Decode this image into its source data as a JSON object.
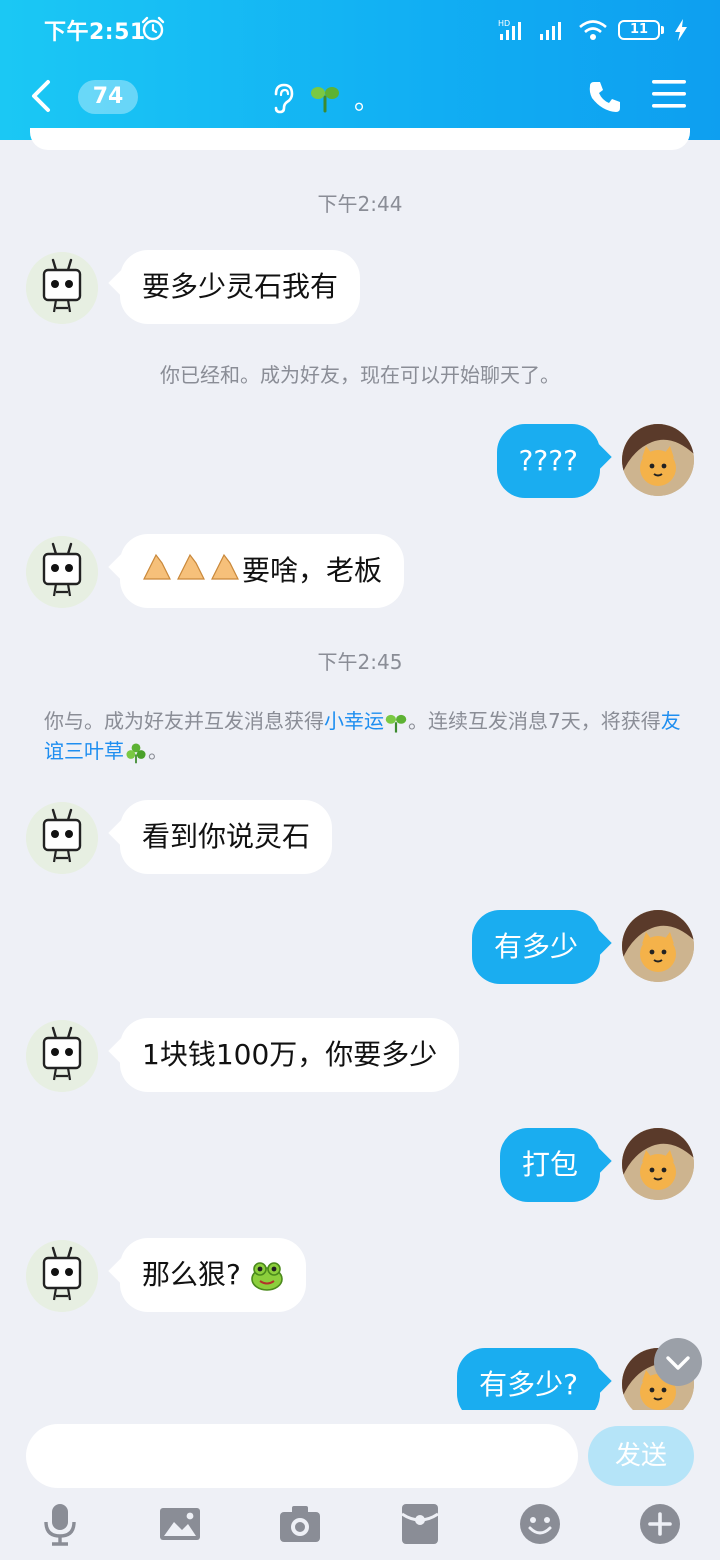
{
  "status_bar": {
    "time": "下午2:51",
    "battery": "11"
  },
  "header": {
    "unread_count": "74",
    "title_suffix": "。"
  },
  "chat": {
    "timestamp_1": "下午2:44",
    "msg_1": "要多少灵石我有",
    "system_1": "你已经和。成为好友，现在可以开始聊天了。",
    "msg_2": "????",
    "msg_3_text": "要啥，老板",
    "timestamp_2": "下午2:45",
    "system_2": {
      "part_1": "你与。成为好友并互发消息获得",
      "link_1": "小幸运",
      "part_2": "。连续互发消息7天，将获得",
      "link_2": "友谊三叶草",
      "part_3": "。"
    },
    "msg_4": "看到你说灵石",
    "msg_5": "有多少",
    "msg_6": "1块钱100万，你要多少",
    "msg_7": "打包",
    "msg_8_text": "那么狠?",
    "msg_9": "有多少?"
  },
  "input": {
    "placeholder": "",
    "send_label": "发送"
  },
  "icons": [
    "alarm-icon",
    "signal-icon",
    "wifi-icon",
    "battery-icon",
    "back-icon",
    "ear-icon",
    "sprout-icon",
    "phone-icon",
    "menu-icon",
    "microphone-icon",
    "image-icon",
    "camera-icon",
    "red-packet-icon",
    "emoji-icon",
    "plus-icon"
  ],
  "colors": {
    "header": "#11aef3",
    "out_bubble": "#1aadf0",
    "send_disabled": "#b5e4f8",
    "link": "#1e8ef0"
  }
}
